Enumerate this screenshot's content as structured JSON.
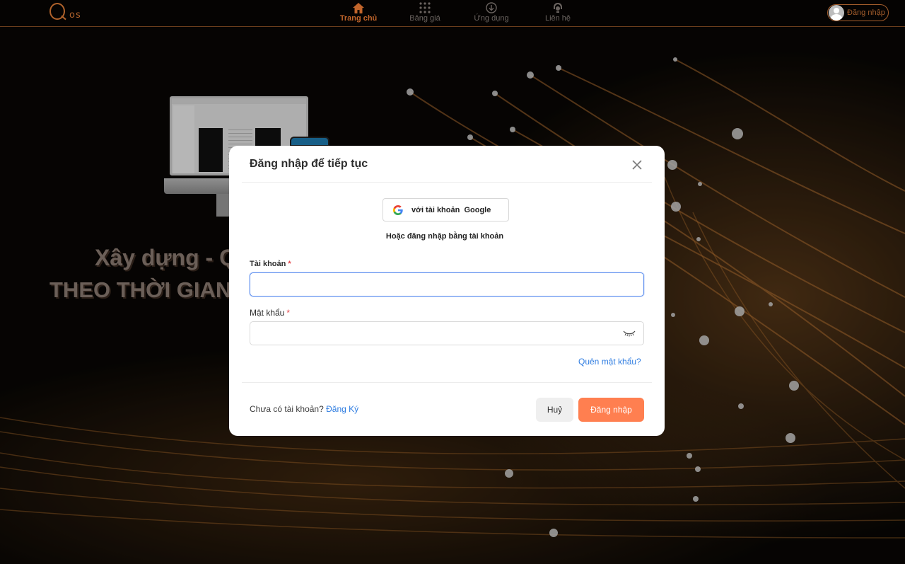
{
  "nav": {
    "logo_text": "os",
    "items": [
      {
        "label": "Trang chủ",
        "icon": "home-icon",
        "active": true
      },
      {
        "label": "Bảng giá",
        "icon": "grid-icon",
        "active": false
      },
      {
        "label": "Ứng dụng",
        "icon": "download-icon",
        "active": false
      },
      {
        "label": "Liên hệ",
        "icon": "support-icon",
        "active": false
      }
    ],
    "login_label": "Đăng nhập"
  },
  "hero": {
    "line1": "Xây dựng - Q",
    "line2": "THEO THỜI GIAN"
  },
  "modal": {
    "title": "Đăng nhập để tiếp tục",
    "google_label": "với tài khoản  Google",
    "or_text": "Hoặc đăng nhập bằng tài khoản",
    "account_label": "Tài khoản",
    "account_value": "",
    "password_label": "Mật khẩu",
    "password_value": "",
    "required_mark": "*",
    "forgot_label": "Quên mật khẩu?",
    "no_account_text": "Chưa có tài khoản?",
    "register_label": "Đăng Ký",
    "cancel_label": "Huỷ",
    "submit_label": "Đăng nhập"
  },
  "colors": {
    "accent": "#ff7f50",
    "nav_active": "#c2652b",
    "link": "#2f7de1"
  }
}
